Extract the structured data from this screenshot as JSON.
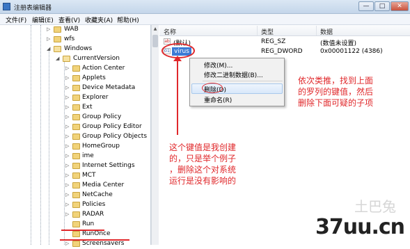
{
  "window": {
    "title": "注册表编辑器",
    "controls": {
      "minimize": "—",
      "maximize": "□",
      "close": "✕"
    }
  },
  "menu": [
    "文件(F)",
    "编辑(E)",
    "查看(V)",
    "收藏夹(A)",
    "帮助(H)"
  ],
  "tree": {
    "top_items": [
      "WAB",
      "wfs",
      "Windows"
    ],
    "current_version": "CurrentVersion",
    "children": [
      "Action Center",
      "Applets",
      "Device Metadata",
      "Explorer",
      "Ext",
      "Group Policy",
      "Group Policy Editor",
      "Group Policy Objects",
      "HomeGroup",
      "ime",
      "Internet Settings",
      "MCT",
      "Media Center",
      "NetCache",
      "Policies",
      "RADAR",
      "Run",
      "RunOnce",
      "Screensavers"
    ]
  },
  "list": {
    "columns": [
      "名称",
      "类型",
      "数据"
    ],
    "rows": [
      {
        "name": "(默认)",
        "type": "REG_SZ",
        "data": "(数值未设置)",
        "icon": "string-value-icon"
      },
      {
        "name": "virus",
        "type": "REG_DWORD",
        "data": "0x00001122 (4386)",
        "icon": "binary-value-icon"
      }
    ]
  },
  "context_menu": {
    "items": [
      "修改(M)...",
      "修改二进制数据(B)...",
      "删除(D)",
      "重命名(R)"
    ],
    "highlighted": "删除(D)"
  },
  "annotations": {
    "right_note": [
      "依次类推，找到上面",
      "的罗列的键值，然后",
      "删除下面可疑的子项"
    ],
    "left_note": [
      "这个键值是我创建",
      "的，只是举个例子",
      "，删除这个对系统",
      "运行是没有影响的"
    ],
    "annotation_color": "#e0282b"
  },
  "watermark": {
    "text": "37uu.cn",
    "faint": "土巴兔"
  },
  "colors": {
    "selection": "#3b7bd6",
    "folder": "#f1d37a"
  }
}
